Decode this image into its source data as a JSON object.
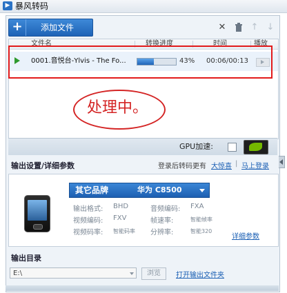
{
  "window": {
    "title": "暴风转码"
  },
  "toolbar": {
    "add_icon": "plus-icon",
    "add_label": "添加文件",
    "icons": [
      "close-icon",
      "trash-icon",
      "arrow-up-icon",
      "arrow-down-icon"
    ]
  },
  "file_list": {
    "columns": [
      "文件名",
      "转换进度",
      "时间",
      "播放"
    ],
    "rows": [
      {
        "name": "0001.音悦台-Ylvis - The Fo...",
        "progress": 43,
        "progress_label": "43%",
        "time": "00:06/00:13"
      }
    ]
  },
  "annotation": {
    "text": "处理中。",
    "color": "#d42424"
  },
  "gpu": {
    "label": "GPU加速:",
    "checked": false
  },
  "output": {
    "title": "输出设置/详细参数",
    "login_text": "登录后转码更有",
    "login_link": "大惊喜",
    "link_separator": "|",
    "signup_link": "马上登录",
    "brand": "其它品牌",
    "model": "华为 C8500",
    "params": [
      {
        "label": "输出格式:",
        "value": "BHD"
      },
      {
        "label": "音频编码:",
        "value": "FXA"
      },
      {
        "label": "视频编码:",
        "value": "FXV"
      },
      {
        "label": "帧速率:",
        "value": "智能帧率"
      },
      {
        "label": "视频码率:",
        "value": "智能码率"
      },
      {
        "label": "分辨率:",
        "value": "智能320"
      }
    ],
    "advanced_link": "详细参数"
  },
  "output_dir": {
    "title": "输出目录",
    "path": "E:\\",
    "browse_label": "浏览",
    "open_link": "打开输出文件夹"
  },
  "colors": {
    "accent": "#1d5fb2",
    "annotation_red": "#e21a1a"
  }
}
